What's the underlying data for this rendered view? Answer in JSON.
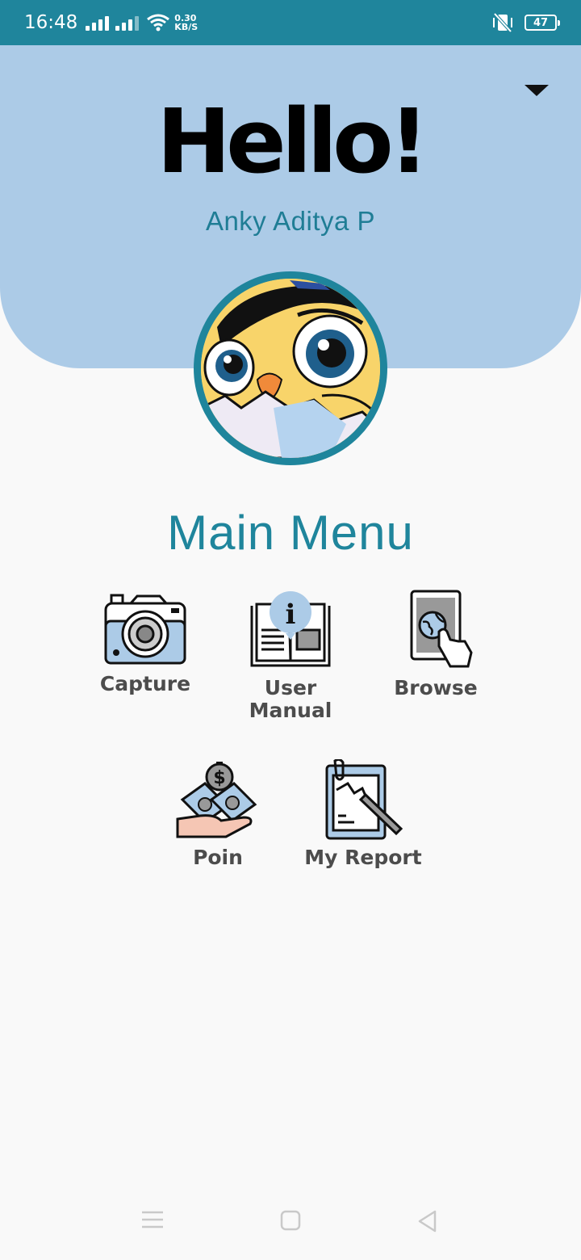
{
  "status_bar": {
    "time": "16:48",
    "net_speed_value": "0.30",
    "net_speed_unit": "KB/S",
    "battery": "47",
    "color": "#1f859c"
  },
  "header": {
    "greeting": "Hello!",
    "user_name": "Anky Aditya P",
    "background": "#accbe7"
  },
  "main_menu": {
    "title": "Main Menu",
    "items": [
      {
        "label": "Capture",
        "icon": "camera-icon"
      },
      {
        "label": "User\nManual",
        "icon": "book-info-icon"
      },
      {
        "label": "Browse",
        "icon": "tablet-globe-icon"
      },
      {
        "label": "Poin",
        "icon": "hand-money-icon"
      },
      {
        "label": "My Report",
        "icon": "clipboard-report-icon"
      }
    ]
  },
  "nav_bar": {
    "buttons": [
      "menu-icon",
      "home-icon",
      "back-icon"
    ]
  }
}
